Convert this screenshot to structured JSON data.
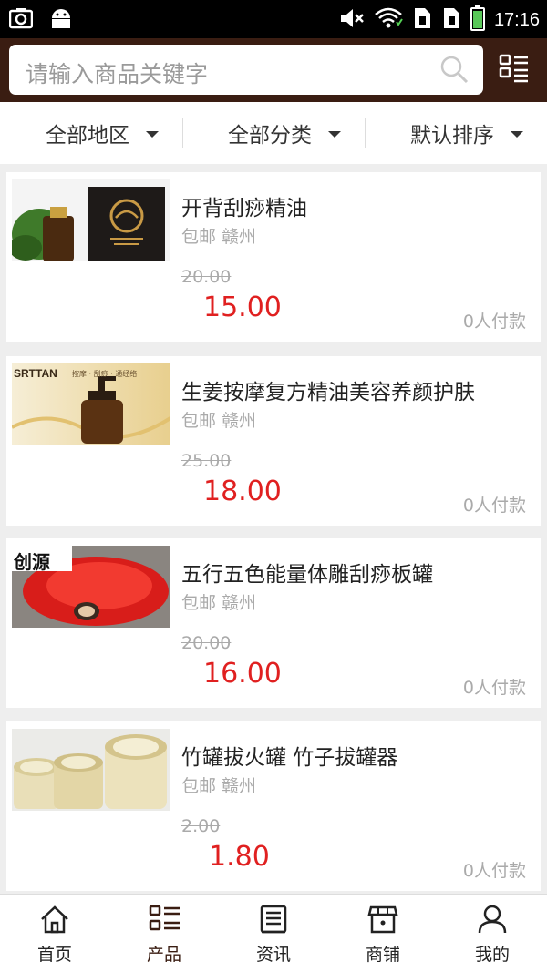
{
  "status_bar": {
    "time": "17:16",
    "icons": [
      "screenshot-icon",
      "android-icon",
      "mute-icon",
      "wifi-icon",
      "sim1-icon",
      "sim2-icon",
      "battery-icon"
    ]
  },
  "search": {
    "placeholder": "请输入商品关键字",
    "search_icon": "search-icon",
    "menu_icon": "grid-list-icon"
  },
  "filters": [
    {
      "label": "全部地区"
    },
    {
      "label": "全部分类"
    },
    {
      "label": "默认排序"
    }
  ],
  "products": [
    {
      "title": "开背刮痧精油",
      "meta": "包邮  赣州",
      "old_price": "20.00",
      "price": "15.00",
      "sold": "0人付款"
    },
    {
      "title": "生姜按摩复方精油美容养颜护肤",
      "meta": "包邮  赣州",
      "old_price": "25.00",
      "price": "18.00",
      "sold": "0人付款"
    },
    {
      "title": "五行五色能量体雕刮痧板罐",
      "meta": "包邮  赣州",
      "old_price": "20.00",
      "price": "16.00",
      "sold": "0人付款"
    },
    {
      "title": "竹罐拔火罐  竹子拔罐器",
      "meta": "包邮  赣州",
      "old_price": "2.00",
      "price": "1.80",
      "sold": "0人付款"
    }
  ],
  "image_text": {
    "srttan": "SRTTAN",
    "srttan_sub": "按摩 · 刮痧 · 通经络",
    "chuangyuan": "创源"
  },
  "nav": [
    {
      "label": "首页",
      "icon": "home-icon"
    },
    {
      "label": "产品",
      "icon": "list-icon",
      "active": true
    },
    {
      "label": "资讯",
      "icon": "news-icon"
    },
    {
      "label": "商铺",
      "icon": "store-icon"
    },
    {
      "label": "我的",
      "icon": "user-icon"
    }
  ],
  "colors": {
    "header": "#3a1d12",
    "price": "#e02020",
    "muted": "#aaaaaa"
  }
}
